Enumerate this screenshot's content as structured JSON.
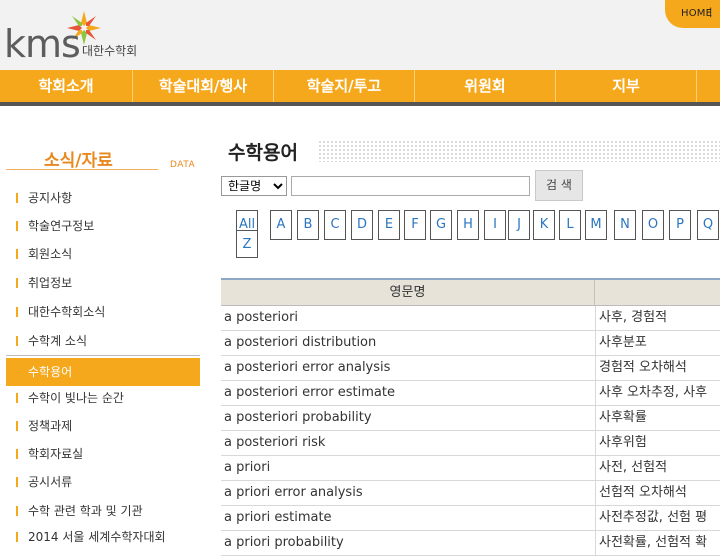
{
  "header": {
    "logo_text": "kms",
    "logo_subtitle": "대한수학회",
    "home_link": "HOME",
    "home_separator": "|"
  },
  "nav": [
    "학회소개",
    "학술대회/행사",
    "학술지/투고",
    "위원회",
    "지부"
  ],
  "sidebar": {
    "title": "소식/자료",
    "title_en": "DATA",
    "items": [
      "공지사항",
      "학술연구정보",
      "회원소식",
      "취업정보",
      "대한수학회소식",
      "수학계 소식",
      "수학용어",
      "수학이 빛나는 순간",
      "정책과제",
      "학회자료실",
      "공시서류",
      "수학 관련 학과 및 기관",
      "2014 서울 세계수학자대회"
    ],
    "active_item": "수학용어"
  },
  "main": {
    "page_title": "수학용어",
    "search": {
      "select_value": "한글명",
      "input_value": "",
      "button_label": "검 색"
    },
    "letters": [
      "All",
      "A",
      "B",
      "C",
      "D",
      "E",
      "F",
      "G",
      "H",
      "I",
      "J",
      "K",
      "L",
      "M",
      "N",
      "O",
      "P",
      "Q",
      "Z"
    ],
    "table": {
      "header_en": "영문명",
      "rows": [
        {
          "en": "a posteriori",
          "ko": "사후, 경험적"
        },
        {
          "en": "a posteriori distribution",
          "ko": "사후분포"
        },
        {
          "en": "a posteriori error analysis",
          "ko": "경험적 오차해석"
        },
        {
          "en": "a posteriori error estimate",
          "ko": "사후 오차추정, 사후"
        },
        {
          "en": "a posteriori probability",
          "ko": "사후확률"
        },
        {
          "en": "a posteriori risk",
          "ko": "사후위험"
        },
        {
          "en": "a priori",
          "ko": "사전, 선험적"
        },
        {
          "en": "a priori error analysis",
          "ko": "선험적 오차해석"
        },
        {
          "en": "a priori estimate",
          "ko": "사전추정값, 선험 평"
        },
        {
          "en": "a priori probability",
          "ko": "사전확률, 선험적 확"
        }
      ]
    }
  },
  "colors": {
    "accent": "#f5a81c",
    "link": "#2b76c0",
    "table_header_bg": "#e7e3d8"
  }
}
